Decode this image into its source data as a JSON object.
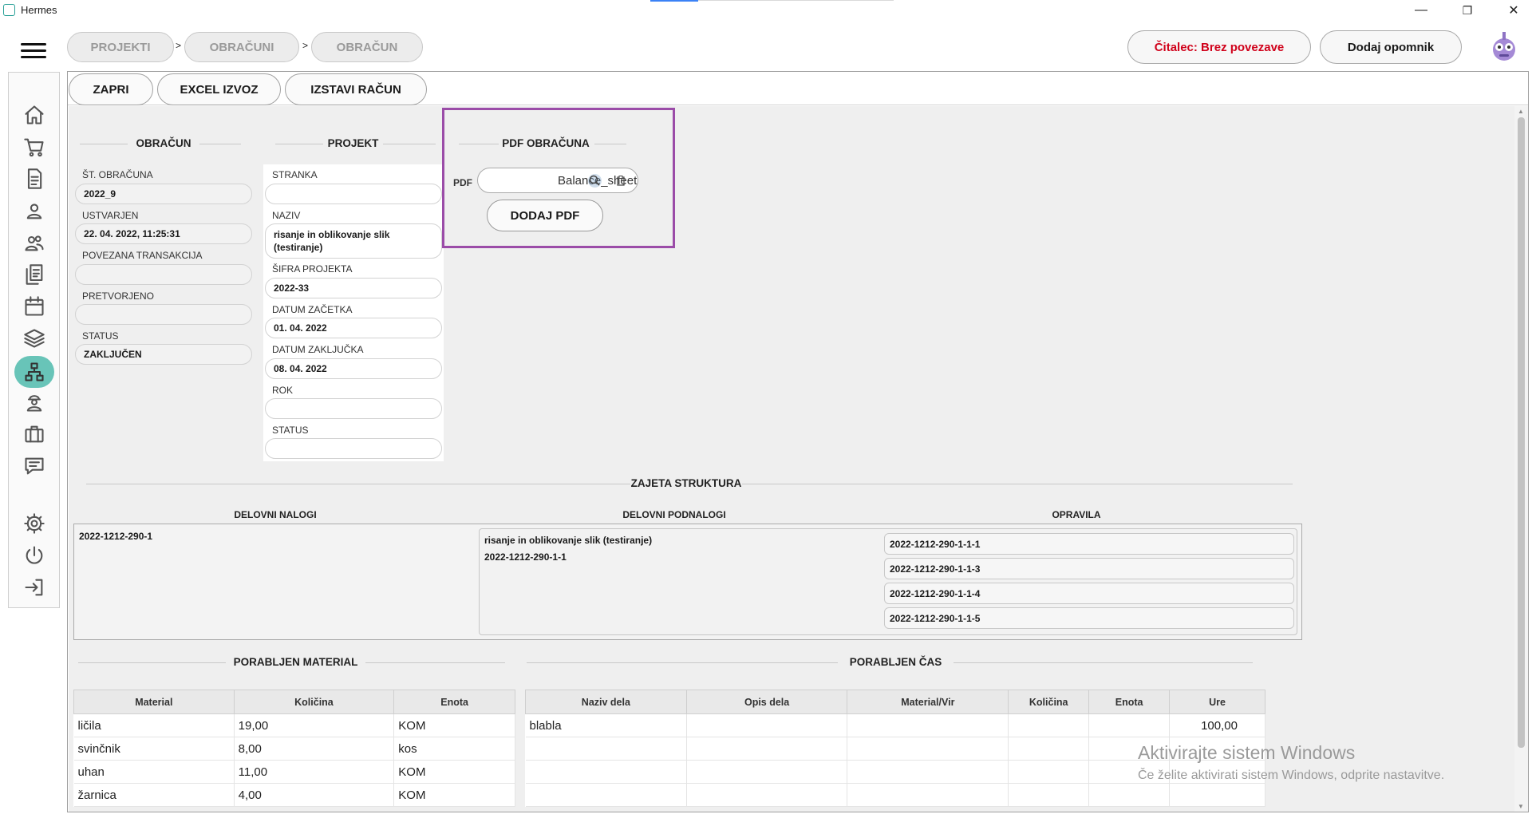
{
  "window": {
    "title": "Hermes",
    "min": "—",
    "max": "❐",
    "close": "✕"
  },
  "breadcrumb": [
    "PROJEKTI",
    "OBRAČUNI",
    "OBRAČUN"
  ],
  "breadcrumb_sep": ">",
  "header": {
    "reader_status": "Čitalec: Brez povezave",
    "reader_color": "#d0021b",
    "add_reminder": "Dodaj opomnik"
  },
  "toolbar": {
    "close": "ZAPRI",
    "excel": "EXCEL IZVOZ",
    "invoice": "IZSTAVI RAČUN"
  },
  "obracun": {
    "title": "OBRAČUN",
    "fields": [
      {
        "label": "ŠT. OBRAČUNA",
        "value": "2022_9"
      },
      {
        "label": "USTVARJEN",
        "value": "22. 04. 2022, 11:25:31"
      },
      {
        "label": "POVEZANA TRANSAKCIJA",
        "value": ""
      },
      {
        "label": "PRETVORJENO",
        "value": ""
      },
      {
        "label": "STATUS",
        "value": "ZAKLJUČEN"
      }
    ]
  },
  "projekt": {
    "title": "PROJEKT",
    "fields": [
      {
        "label": "STRANKA",
        "value": ""
      },
      {
        "label": "NAZIV",
        "value": "risanje in oblikovanje slik (testiranje)"
      },
      {
        "label": "ŠIFRA PROJEKTA",
        "value": "2022-33"
      },
      {
        "label": "DATUM ZAČETKA",
        "value": "01. 04. 2022"
      },
      {
        "label": "DATUM ZAKLJUČKA",
        "value": "08. 04. 2022"
      },
      {
        "label": "ROK",
        "value": ""
      },
      {
        "label": "STATUS",
        "value": ""
      }
    ]
  },
  "pdf": {
    "title": "PDF OBRAČUNA",
    "label": "PDF",
    "value": "Balance_sheet",
    "button": "DODAJ PDF",
    "highlight_color": "#9b4ca8"
  },
  "structure": {
    "title": "ZAJETA STRUKTURA",
    "col_orders": "DELOVNI NALOGI",
    "col_suborders": "DELOVNI PODNALOGI",
    "col_tasks": "OPRAVILA",
    "order": "2022-1212-290-1",
    "suborder_name": "risanje in oblikovanje slik (testiranje)",
    "suborder_code": "2022-1212-290-1-1",
    "tasks": [
      "2022-1212-290-1-1-1",
      "2022-1212-290-1-1-3",
      "2022-1212-290-1-1-4",
      "2022-1212-290-1-1-5"
    ]
  },
  "material": {
    "title": "PORABLJEN MATERIAL",
    "headers": [
      "Material",
      "Količina",
      "Enota"
    ],
    "rows": [
      [
        "ličila",
        "19,00",
        "KOM"
      ],
      [
        "svinčnik",
        "8,00",
        "kos"
      ],
      [
        "uhan",
        "11,00",
        "KOM"
      ],
      [
        "žarnica",
        "4,00",
        "KOM"
      ]
    ]
  },
  "cas": {
    "title": "PORABLJEN ČAS",
    "headers": [
      "Naziv dela",
      "Opis dela",
      "Material/Vir",
      "Količina",
      "Enota",
      "Ure"
    ],
    "rows": [
      [
        "blabla",
        "",
        "",
        "",
        "",
        "100,00"
      ],
      [
        "",
        "",
        "",
        "",
        "",
        ""
      ],
      [
        "",
        "",
        "",
        "",
        "",
        ""
      ],
      [
        "",
        "",
        "",
        "",
        "",
        ""
      ]
    ]
  },
  "watermark": {
    "line1": "Aktivirajte sistem Windows",
    "line2": "Če želite aktivirati sistem Windows, odprite nastavitve."
  },
  "sidebar_icons": [
    "home-icon",
    "cart-icon",
    "document-icon",
    "person-icon",
    "people-icon",
    "documents-icon",
    "calendar-icon",
    "layers-icon",
    "hierarchy-icon",
    "worker-icon",
    "briefcase-icon",
    "chat-icon",
    "gear-icon",
    "power-icon",
    "logout-icon"
  ],
  "colors": {
    "active_sidebar": "#68c4b8",
    "accent": "#2aa198"
  }
}
